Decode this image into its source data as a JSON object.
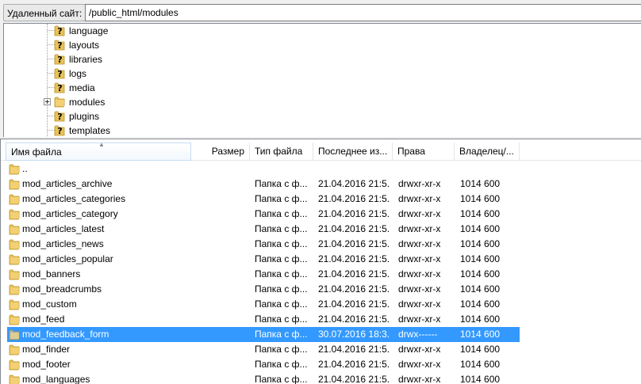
{
  "pathbar": {
    "label": "Удаленный сайт:",
    "value": "/public_html/modules"
  },
  "tree": {
    "items": [
      {
        "label": "language",
        "icon": "unknown-folder-icon"
      },
      {
        "label": "layouts",
        "icon": "unknown-folder-icon"
      },
      {
        "label": "libraries",
        "icon": "unknown-folder-icon"
      },
      {
        "label": "logs",
        "icon": "unknown-folder-icon"
      },
      {
        "label": "media",
        "icon": "unknown-folder-icon"
      },
      {
        "label": "modules",
        "icon": "folder-icon",
        "expandable": true
      },
      {
        "label": "plugins",
        "icon": "unknown-folder-icon"
      },
      {
        "label": "templates",
        "icon": "unknown-folder-icon"
      }
    ]
  },
  "filelist": {
    "columns": {
      "name": "Имя файла",
      "size": "Размер",
      "type": "Тип файла",
      "modified": "Последнее из...",
      "perms": "Права",
      "owner": "Владелец/..."
    },
    "sorted_column": "name",
    "rows": [
      {
        "name": "..",
        "type": "",
        "modified": "",
        "perms": "",
        "owner": ""
      },
      {
        "name": "mod_articles_archive",
        "type": "Папка с ф...",
        "modified": "21.04.2016 21:5...",
        "perms": "drwxr-xr-x",
        "owner": "1014 600"
      },
      {
        "name": "mod_articles_categories",
        "type": "Папка с ф...",
        "modified": "21.04.2016 21:5...",
        "perms": "drwxr-xr-x",
        "owner": "1014 600"
      },
      {
        "name": "mod_articles_category",
        "type": "Папка с ф...",
        "modified": "21.04.2016 21:5...",
        "perms": "drwxr-xr-x",
        "owner": "1014 600"
      },
      {
        "name": "mod_articles_latest",
        "type": "Папка с ф...",
        "modified": "21.04.2016 21:5...",
        "perms": "drwxr-xr-x",
        "owner": "1014 600"
      },
      {
        "name": "mod_articles_news",
        "type": "Папка с ф...",
        "modified": "21.04.2016 21:5...",
        "perms": "drwxr-xr-x",
        "owner": "1014 600"
      },
      {
        "name": "mod_articles_popular",
        "type": "Папка с ф...",
        "modified": "21.04.2016 21:5...",
        "perms": "drwxr-xr-x",
        "owner": "1014 600"
      },
      {
        "name": "mod_banners",
        "type": "Папка с ф...",
        "modified": "21.04.2016 21:5...",
        "perms": "drwxr-xr-x",
        "owner": "1014 600"
      },
      {
        "name": "mod_breadcrumbs",
        "type": "Папка с ф...",
        "modified": "21.04.2016 21:5...",
        "perms": "drwxr-xr-x",
        "owner": "1014 600"
      },
      {
        "name": "mod_custom",
        "type": "Папка с ф...",
        "modified": "21.04.2016 21:5...",
        "perms": "drwxr-xr-x",
        "owner": "1014 600"
      },
      {
        "name": "mod_feed",
        "type": "Папка с ф...",
        "modified": "21.04.2016 21:5...",
        "perms": "drwxr-xr-x",
        "owner": "1014 600"
      },
      {
        "name": "mod_feedback_form",
        "type": "Папка с ф...",
        "modified": "30.07.2016 18:3...",
        "perms": "drwx------",
        "owner": "1014 600",
        "selected": true
      },
      {
        "name": "mod_finder",
        "type": "Папка с ф...",
        "modified": "21.04.2016 21:5...",
        "perms": "drwxr-xr-x",
        "owner": "1014 600"
      },
      {
        "name": "mod_footer",
        "type": "Папка с ф...",
        "modified": "21.04.2016 21:5...",
        "perms": "drwxr-xr-x",
        "owner": "1014 600"
      },
      {
        "name": "mod_languages",
        "type": "Папка с ф...",
        "modified": "21.04.2016 21:5...",
        "perms": "drwxr-xr-x",
        "owner": "1014 600"
      }
    ]
  },
  "colors": {
    "selection": "#3399ff",
    "folder": "#e8c25a",
    "tree_line": "#a0a0a0"
  }
}
